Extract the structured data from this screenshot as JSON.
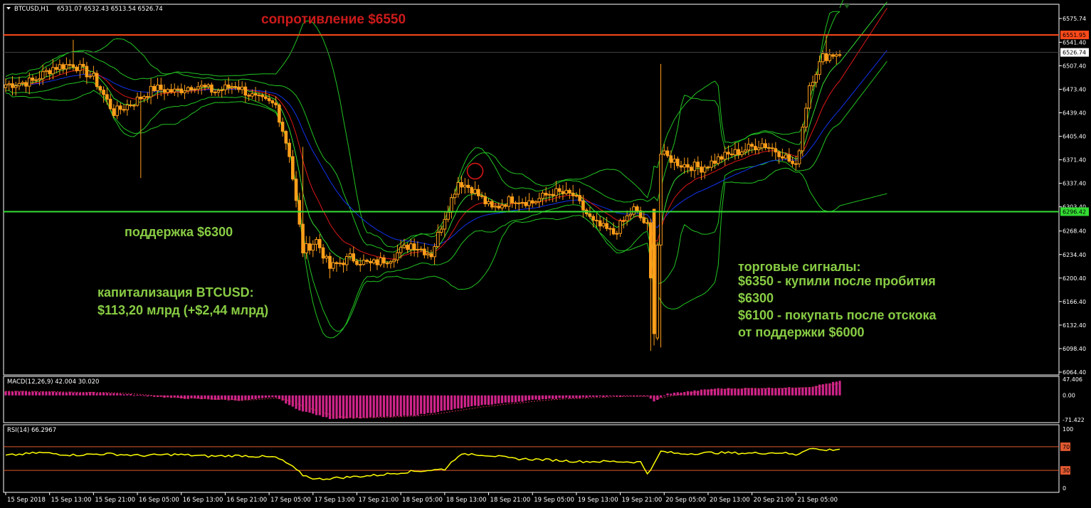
{
  "header": {
    "symbol": "BTCUSD,H1",
    "ohlc": "6531.07 6532.43 6513.54 6526.74"
  },
  "colors": {
    "background": "#000000",
    "axis": "#ffffff",
    "bull": "#ff9f1a",
    "bear": "#ff9f1a",
    "bollinger": "#22c322",
    "ma_red": "#e01818",
    "ma_green": "#33dd33",
    "ma_blue": "#1133ee",
    "resistance": "#ff4a1a",
    "support": "#33dd33",
    "macd": "#d0248a",
    "macd_signal": "#c03050",
    "rsi": "#ffff00",
    "rsi_level": "#e05830",
    "ann_red": "#cc1a1a",
    "ann_green": "#88cc44"
  },
  "annotations": {
    "resistance": "сопротивление $6550",
    "support": "поддержка $6300",
    "cap_line1": "капитализация BTCUSD:",
    "cap_line2": "$113,20 млрд (+$2,44 млрд)",
    "signals": [
      "торговые сигналы:",
      "$6350 - купили после пробития",
      "$6300",
      "$6100 - покупать после отскока",
      "от поддержки $6000"
    ]
  },
  "chart_data": [
    {
      "type": "candlestick",
      "title": "BTCUSD,H1",
      "ylim": [
        6064.4,
        6575.74
      ],
      "yticks": [
        6575.74,
        6541.4,
        6507.4,
        6473.4,
        6439.4,
        6405.4,
        6371.4,
        6337.4,
        6303.4,
        6268.4,
        6234.4,
        6200.4,
        6166.4,
        6132.4,
        6098.4,
        6064.4
      ],
      "price_labels": [
        {
          "value": 6551.95,
          "label": "6551.95",
          "color": "#ff4a1a"
        },
        {
          "value": 6526.74,
          "label": "6526.74",
          "color": "#ffffff"
        },
        {
          "value": 6296.42,
          "label": "6296.42",
          "color": "#33dd33"
        }
      ],
      "levels": {
        "resistance": 6550,
        "support": 6300
      },
      "xticks": [
        "15 Sep 2018",
        "15 Sep 13:00",
        "15 Sep 21:00",
        "16 Sep 05:00",
        "16 Sep 13:00",
        "16 Sep 21:00",
        "17 Sep 05:00",
        "17 Sep 13:00",
        "17 Sep 21:00",
        "18 Sep 05:00",
        "18 Sep 13:00",
        "18 Sep 21:00",
        "19 Sep 05:00",
        "19 Sep 13:00",
        "19 Sep 21:00",
        "20 Sep 05:00",
        "20 Sep 13:00",
        "20 Sep 21:00",
        "21 Sep 05:00"
      ],
      "close_anchors": [
        [
          0,
          6480
        ],
        [
          8,
          6485
        ],
        [
          14,
          6505
        ],
        [
          20,
          6510
        ],
        [
          26,
          6490
        ],
        [
          32,
          6440
        ],
        [
          38,
          6455
        ],
        [
          44,
          6475
        ],
        [
          50,
          6470
        ],
        [
          56,
          6480
        ],
        [
          62,
          6470
        ],
        [
          68,
          6480
        ],
        [
          74,
          6460
        ],
        [
          80,
          6450
        ],
        [
          84,
          6380
        ],
        [
          88,
          6240
        ],
        [
          92,
          6255
        ],
        [
          96,
          6215
        ],
        [
          102,
          6230
        ],
        [
          108,
          6220
        ],
        [
          114,
          6230
        ],
        [
          120,
          6250
        ],
        [
          126,
          6235
        ],
        [
          130,
          6290
        ],
        [
          134,
          6340
        ],
        [
          138,
          6330
        ],
        [
          144,
          6300
        ],
        [
          150,
          6315
        ],
        [
          156,
          6310
        ],
        [
          162,
          6325
        ],
        [
          168,
          6320
        ],
        [
          174,
          6280
        ],
        [
          180,
          6265
        ],
        [
          186,
          6300
        ],
        [
          190,
          6275
        ],
        [
          192,
          6120
        ],
        [
          194,
          6380
        ],
        [
          200,
          6365
        ],
        [
          206,
          6360
        ],
        [
          212,
          6375
        ],
        [
          218,
          6385
        ],
        [
          224,
          6395
        ],
        [
          230,
          6380
        ],
        [
          234,
          6360
        ],
        [
          238,
          6480
        ],
        [
          242,
          6520
        ],
        [
          247,
          6527
        ]
      ],
      "indicators": [
        "Bollinger Bands",
        "MA red",
        "MA green",
        "MA blue"
      ]
    },
    {
      "type": "bar",
      "title": "MACD(12,26,9) 42.004 30.020",
      "ylim": [
        -71.422,
        47.406
      ],
      "yticks": [
        47.406,
        0.0,
        -71.422
      ],
      "anchors": [
        [
          0,
          12
        ],
        [
          30,
          8
        ],
        [
          50,
          -8
        ],
        [
          70,
          -15
        ],
        [
          80,
          -5
        ],
        [
          86,
          -40
        ],
        [
          96,
          -68
        ],
        [
          106,
          -66
        ],
        [
          120,
          -60
        ],
        [
          140,
          -30
        ],
        [
          160,
          -10
        ],
        [
          180,
          -3
        ],
        [
          190,
          -2
        ],
        [
          192,
          -18
        ],
        [
          196,
          5
        ],
        [
          210,
          20
        ],
        [
          230,
          22
        ],
        [
          238,
          25
        ],
        [
          247,
          42
        ]
      ]
    },
    {
      "type": "line",
      "title": "RSI(14) 66.2967",
      "ylim": [
        0,
        100
      ],
      "yticks": [
        100,
        70,
        30,
        0
      ],
      "levels": [
        70,
        30
      ],
      "anchors": [
        [
          0,
          55
        ],
        [
          10,
          60
        ],
        [
          20,
          56
        ],
        [
          30,
          58
        ],
        [
          40,
          55
        ],
        [
          50,
          57
        ],
        [
          60,
          54
        ],
        [
          70,
          55
        ],
        [
          80,
          52
        ],
        [
          84,
          40
        ],
        [
          88,
          22
        ],
        [
          92,
          15
        ],
        [
          100,
          18
        ],
        [
          110,
          22
        ],
        [
          120,
          28
        ],
        [
          130,
          32
        ],
        [
          134,
          55
        ],
        [
          138,
          58
        ],
        [
          144,
          55
        ],
        [
          150,
          50
        ],
        [
          160,
          48
        ],
        [
          170,
          45
        ],
        [
          180,
          45
        ],
        [
          188,
          44
        ],
        [
          190,
          25
        ],
        [
          192,
          40
        ],
        [
          194,
          62
        ],
        [
          200,
          58
        ],
        [
          210,
          60
        ],
        [
          220,
          59
        ],
        [
          230,
          60
        ],
        [
          234,
          56
        ],
        [
          238,
          68
        ],
        [
          242,
          64
        ],
        [
          247,
          66
        ]
      ]
    }
  ]
}
